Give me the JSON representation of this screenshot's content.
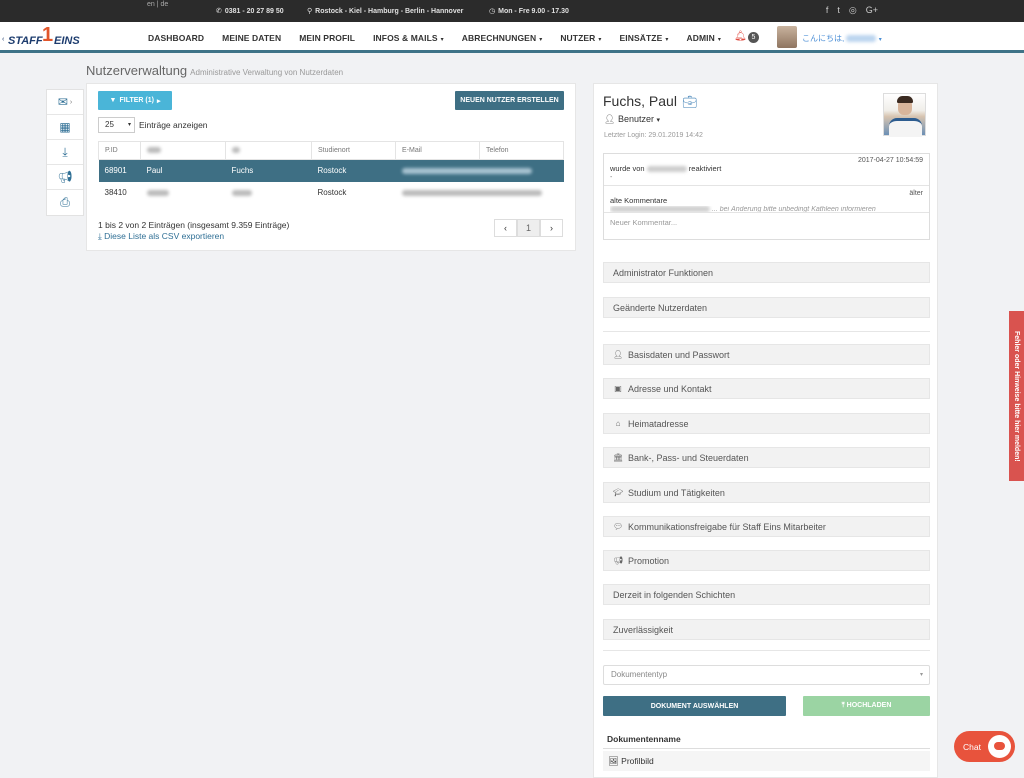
{
  "topbar": {
    "lang": "en | de",
    "phone": "0381 - 20 27 89 50",
    "locations": "Rostock - Kiel - Hamburg - Berlin - Hannover",
    "hours": "Mon - Fre 9.00 - 17.30",
    "social": [
      "f",
      "t",
      "ig",
      "G+"
    ]
  },
  "brand": {
    "left": "STAFF",
    "right": "EINS"
  },
  "nav": {
    "items": [
      {
        "label": "DASHBOARD",
        "caret": false
      },
      {
        "label": "MEINE DATEN",
        "caret": false
      },
      {
        "label": "MEIN PROFIL",
        "caret": false
      },
      {
        "label": "INFOS & MAILS",
        "caret": true
      },
      {
        "label": "ABRECHNUNGEN",
        "caret": true
      },
      {
        "label": "NUTZER",
        "caret": true
      },
      {
        "label": "EINSÄTZE",
        "caret": true
      },
      {
        "label": "ADMIN",
        "caret": true
      }
    ],
    "notif_count": "5",
    "greeting": "こんにちは,"
  },
  "page": {
    "title": "Nutzerverwaltung",
    "subtitle": "Administrative Verwaltung von Nutzerdaten"
  },
  "left": {
    "filter_label": "FILTER (1)",
    "new_user_label": "NEUEN NUTZER ERSTELLEN",
    "page_len": "25",
    "page_len_suffix": "Einträge anzeigen",
    "columns": [
      "P.ID",
      "",
      "",
      "Studienort",
      "E-Mail",
      "Telefon"
    ],
    "rows": [
      {
        "pid": "68901",
        "first": "Paul",
        "last": "Fuchs",
        "city": "Rostock"
      },
      {
        "pid": "38410",
        "first": "",
        "last": "",
        "city": "Rostock"
      }
    ],
    "info": "1 bis 2 von 2 Einträgen (insgesamt 9.359 Einträge)",
    "csv": "Diese Liste als CSV exportieren",
    "pager": {
      "prev": "‹",
      "page": "1",
      "next": "›"
    }
  },
  "profile": {
    "name": "Fuchs, Paul",
    "role": "Benutzer",
    "last_login": "Letzter Login: 29.01.2019 14:42",
    "comment_date": "2017-04-27 10:54:59",
    "comment_text_pre": "wurde von",
    "comment_text_post": "reaktiviert",
    "comment_dash": "-",
    "older_label": "älter",
    "old_comments_label": "alte Kommentare",
    "old_comment_text": "... bei Änderung bitte unbedingt Kathleen informieren",
    "new_comment_placeholder": "Neuer Kommentar..."
  },
  "sections": [
    {
      "label": "Administrator Funktionen",
      "icon": ""
    },
    {
      "label": "Geänderte Nutzerdaten",
      "icon": ""
    },
    {
      "label": "Basisdaten und Passwort",
      "icon": "user-icon"
    },
    {
      "label": "Adresse und Kontakt",
      "icon": "contact-card-icon"
    },
    {
      "label": "Heimatadresse",
      "icon": "home-icon"
    },
    {
      "label": "Bank-, Pass- und Steuerdaten",
      "icon": "bank-icon"
    },
    {
      "label": "Studium und Tätigkeiten",
      "icon": "graduation-cap-icon"
    },
    {
      "label": "Kommunikationsfreigabe für Staff Eins Mitarbeiter",
      "icon": "chat-icon"
    },
    {
      "label": "Promotion",
      "icon": "megaphone-icon"
    },
    {
      "label": "Derzeit in folgenden Schichten",
      "icon": ""
    },
    {
      "label": "Zuverlässigkeit",
      "icon": ""
    }
  ],
  "documents": {
    "type_placeholder": "Dokumententyp",
    "select_label": "DOKUMENT AUSWÄHLEN",
    "upload_label": "HOCHLADEN",
    "header": "Dokumentenname",
    "rows": [
      "Profilbild"
    ]
  },
  "feedback": "Fehler oder Hinweise bitte hier melden!",
  "chat": "Chat",
  "colors": {
    "primary": "#3e6f84",
    "filter": "#4ab5d8",
    "upload": "#9bd4a3",
    "feedback": "#d9534f",
    "chat": "#e8533c"
  }
}
